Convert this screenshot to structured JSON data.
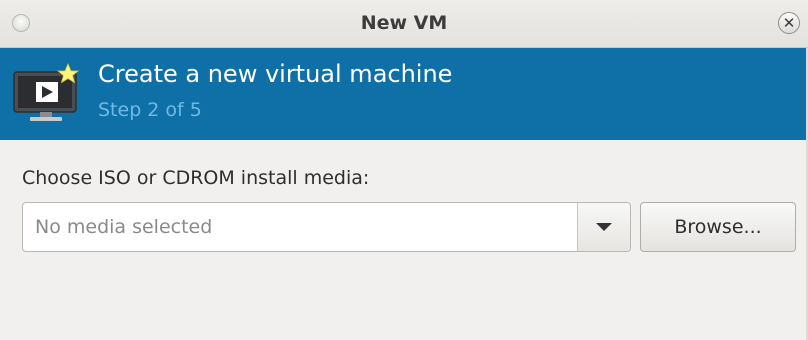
{
  "window": {
    "title": "New VM",
    "close_glyph": "✕",
    "accent": "#0f70a8",
    "step_color": "#6fb9e6"
  },
  "banner": {
    "heading": "Create a new virtual machine",
    "step": "Step 2 of 5",
    "icon": "vm-monitor-icon"
  },
  "media": {
    "label": "Choose ISO or CDROM install media:",
    "placeholder": "No media selected",
    "value": "",
    "dropdown_icon": "chevron-down-icon",
    "browse_label": "Browse..."
  }
}
